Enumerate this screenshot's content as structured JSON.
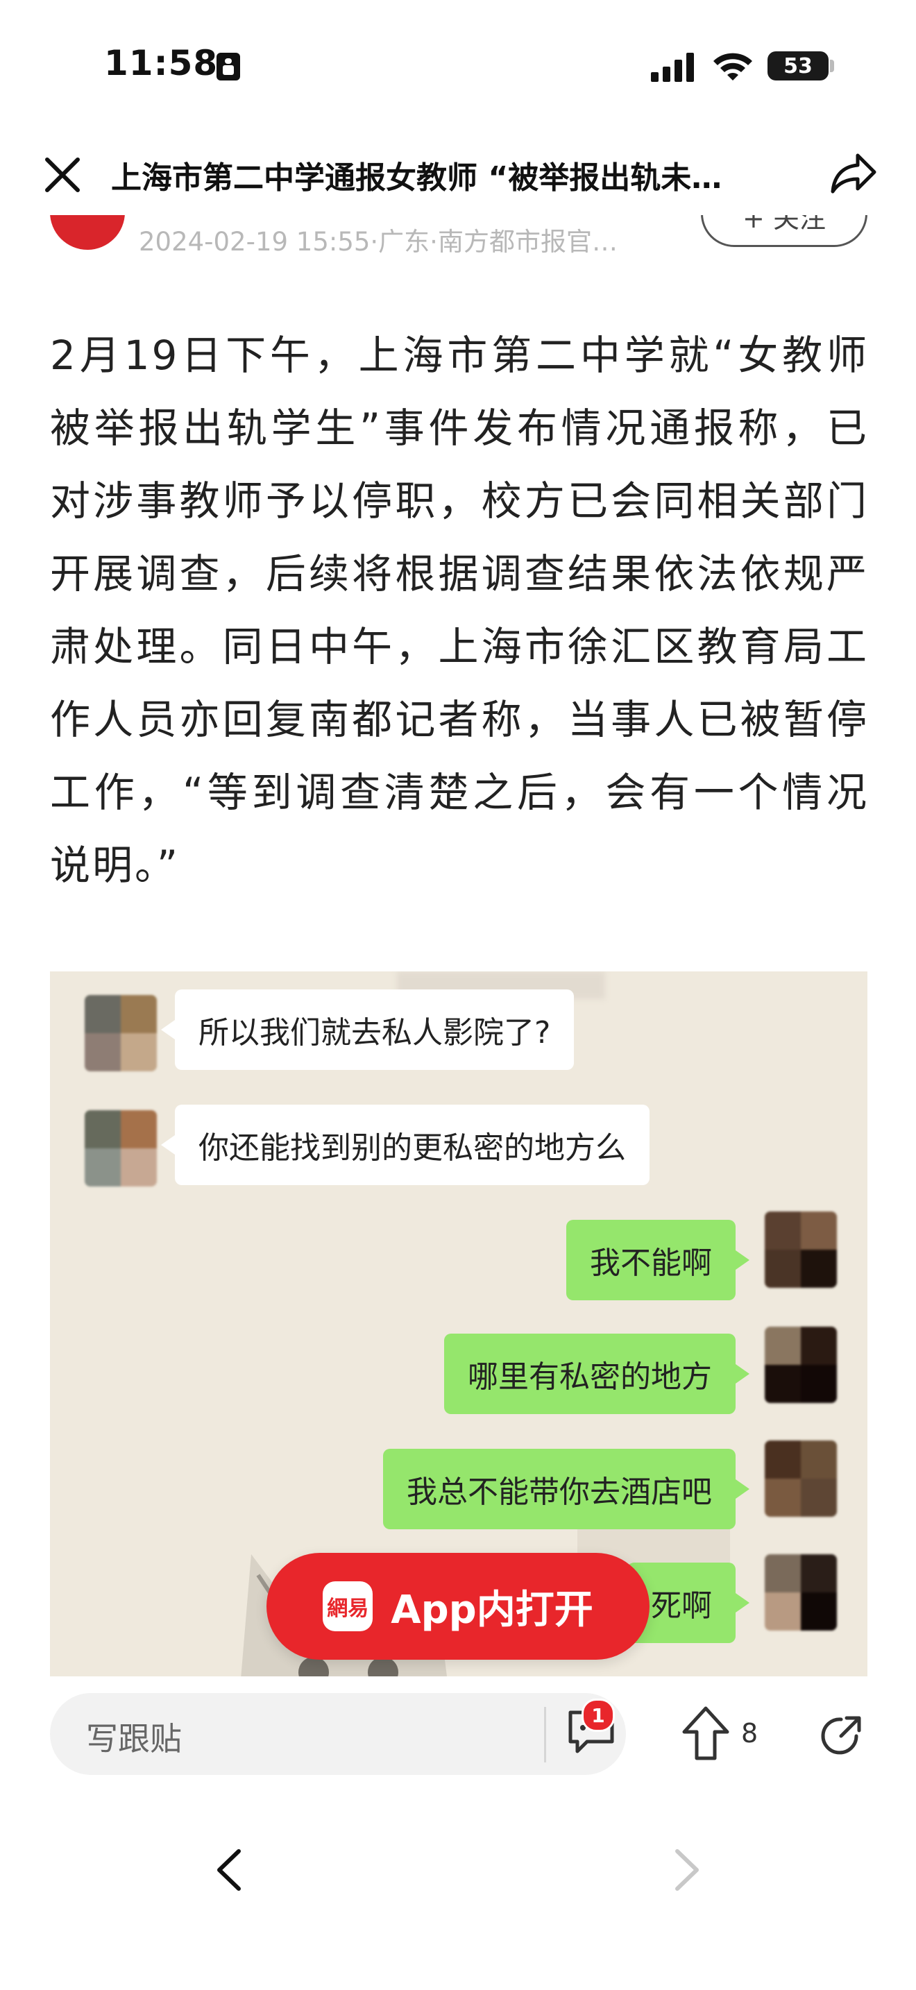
{
  "status_bar": {
    "time": "11:58",
    "battery": "53"
  },
  "nav": {
    "title": "上海市第二中学通报女教师 “被举报出轨未…"
  },
  "meta": {
    "text": "2024-02-19 15:55·广东·南方都市报官…",
    "follow_label": "+ 关注"
  },
  "article": {
    "body": "2月19日下午，上海市第二中学就“女教师被举报出轨学生”事件发布情况通报称，已对涉事教师予以停职，校方已会同相关部门开展调查，后续将根据调查结果依法依规严肃处理。同日中午，上海市徐汇区教育局工作人员亦回复南都记者称，当事人已被暂停工作，“等到调查清楚之后，会有一个情况说明。”"
  },
  "chat_image": {
    "messages": [
      {
        "side": "left",
        "text": "所以我们就去私人影院了?"
      },
      {
        "side": "left",
        "text": "你还能找到别的更私密的地方么"
      },
      {
        "side": "right",
        "text": "我不能啊"
      },
      {
        "side": "right",
        "text": "哪里有私密的地方"
      },
      {
        "side": "right",
        "text": "我总不能带你去酒店吧"
      },
      {
        "side": "right",
        "text": "死啊"
      }
    ]
  },
  "app_button": {
    "label": "App内打开",
    "logo_text": "網易"
  },
  "toolbar": {
    "comment_placeholder": "写跟贴",
    "comment_badge": "1",
    "upvote_count": "8"
  },
  "colors": {
    "accent": "#e8262b",
    "bubble_green": "#95e66c"
  },
  "icons": [
    "lock-icon",
    "signal-icon",
    "wifi-icon",
    "close-icon",
    "share-icon",
    "comment-icon",
    "upvote-icon",
    "share-outline-icon",
    "back-icon",
    "forward-icon"
  ]
}
